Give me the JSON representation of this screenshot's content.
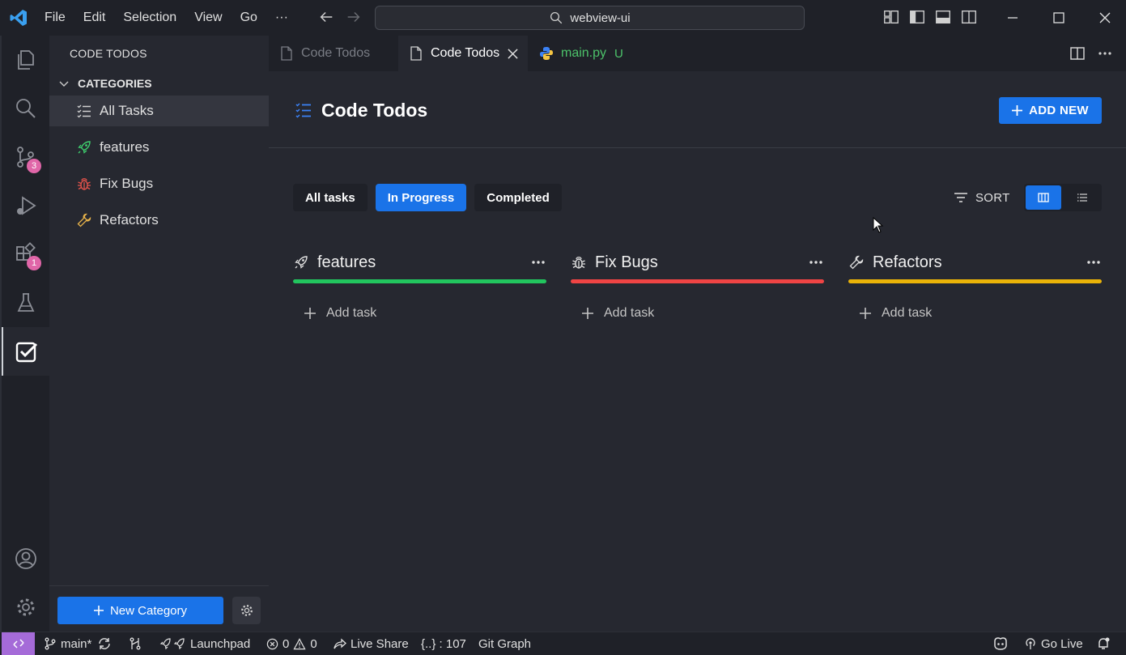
{
  "titlebar": {
    "menu": [
      "File",
      "Edit",
      "Selection",
      "View",
      "Go",
      "···"
    ],
    "search_text": "webview-ui"
  },
  "activity": {
    "source_control_badge": "3",
    "extensions_badge": "1"
  },
  "sidebar": {
    "title": "CODE TODOS",
    "section": "CATEGORIES",
    "items": [
      {
        "label": "All Tasks",
        "icon": "list-icon"
      },
      {
        "label": "features",
        "icon": "rocket-icon",
        "color": "#3ecf6e"
      },
      {
        "label": "Fix Bugs",
        "icon": "bug-icon",
        "color": "#e5534b"
      },
      {
        "label": "Refactors",
        "icon": "wrench-icon",
        "color": "#e8b34a"
      }
    ],
    "new_category": "New Category"
  },
  "tabs": [
    {
      "label": "Code Todos",
      "active": false
    },
    {
      "label": "Code Todos",
      "active": true
    },
    {
      "label": "main.py",
      "status": "U"
    }
  ],
  "main": {
    "title": "Code Todos",
    "add_new": "ADD NEW",
    "filters": [
      "All tasks",
      "In Progress",
      "Completed"
    ],
    "active_filter": "In Progress",
    "sort": "SORT",
    "columns": [
      {
        "title": "features",
        "color": "#22c55e",
        "add_task": "Add task"
      },
      {
        "title": "Fix Bugs",
        "color": "#ef4444",
        "add_task": "Add task"
      },
      {
        "title": "Refactors",
        "color": "#eab308",
        "add_task": "Add task"
      }
    ]
  },
  "statusbar": {
    "branch": "main*",
    "launchpad": "Launchpad",
    "errors": "0",
    "warnings": "0",
    "live_share": "Live Share",
    "braces": "{..} : 107",
    "git_graph": "Git Graph",
    "go_live": "Go Live"
  }
}
